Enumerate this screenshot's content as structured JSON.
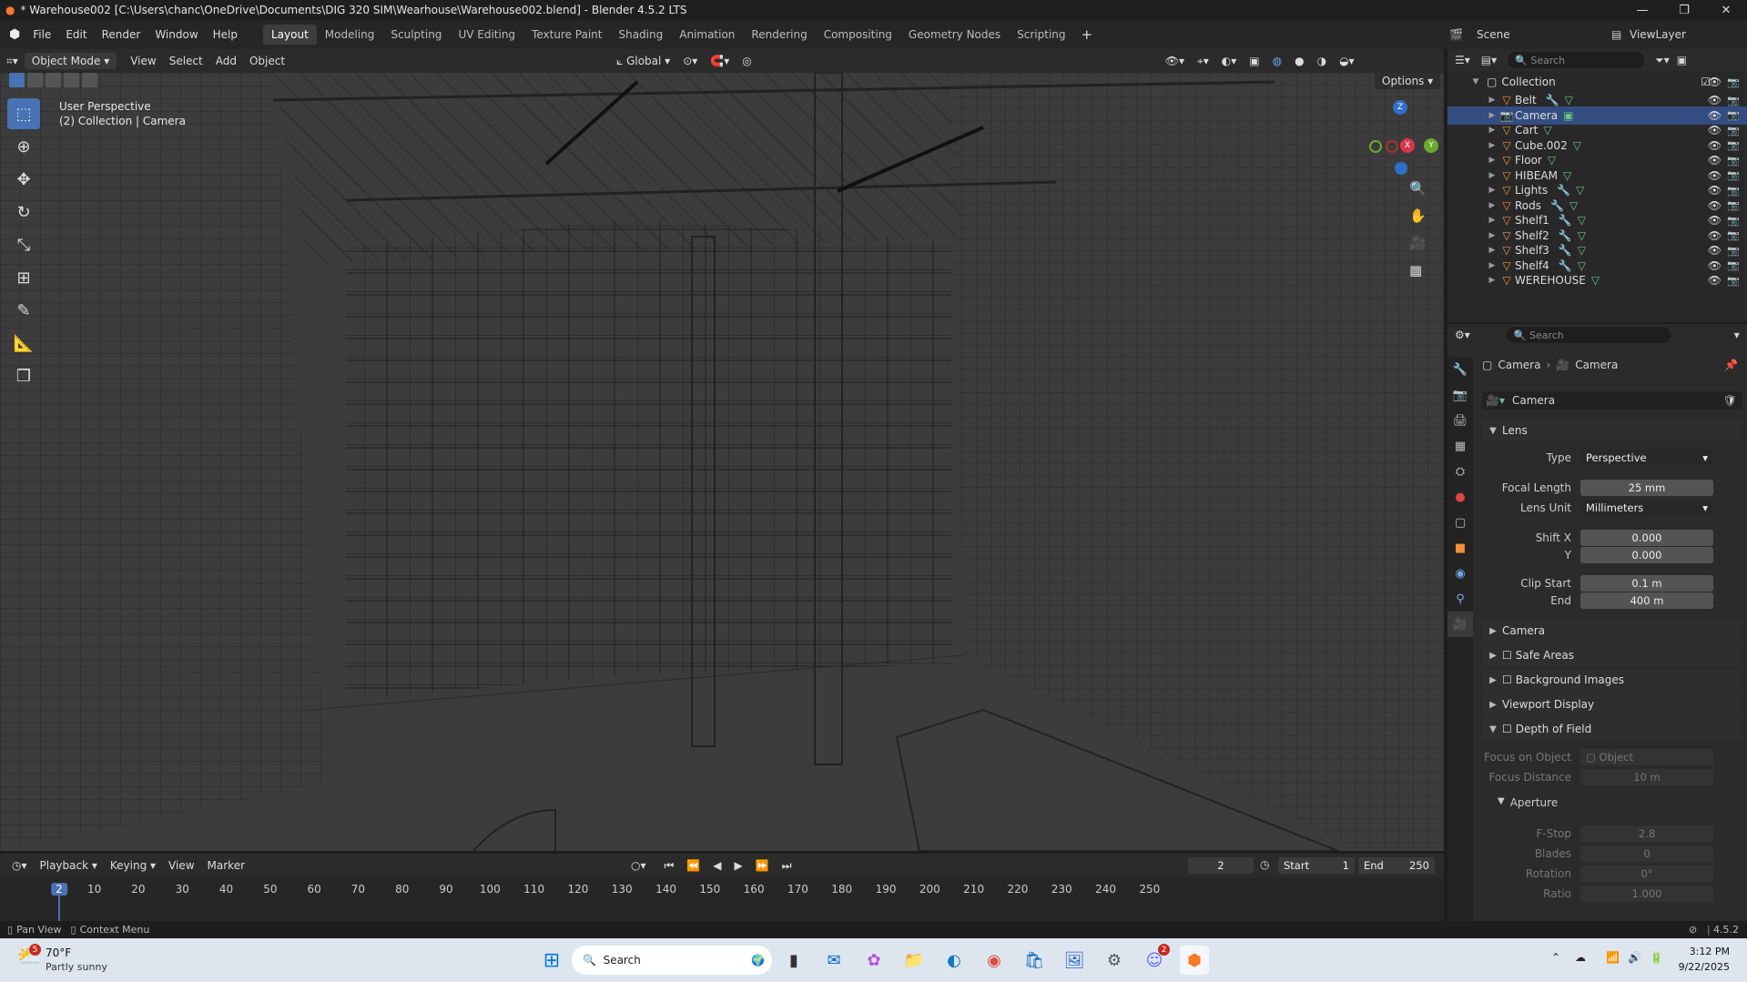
{
  "title": "* Warehouse002 [C:\\Users\\chanc\\OneDrive\\Documents\\DIG 320 SIM\\Wearhouse\\Warehouse002.blend] - Blender 4.5.2 LTS",
  "menu": [
    "File",
    "Edit",
    "Render",
    "Window",
    "Help"
  ],
  "workspaces": [
    "Layout",
    "Modeling",
    "Sculpting",
    "UV Editing",
    "Texture Paint",
    "Shading",
    "Animation",
    "Rendering",
    "Compositing",
    "Geometry Nodes",
    "Scripting"
  ],
  "active_workspace": "Layout",
  "scene": {
    "label": "Scene",
    "view_layer": "ViewLayer"
  },
  "viewport": {
    "mode": "Object Mode",
    "menus": [
      "View",
      "Select",
      "Add",
      "Object"
    ],
    "transform": "Global",
    "options": "Options",
    "overlay_line1": "User Perspective",
    "overlay_line2": "(2) Collection | Camera",
    "gizmo": {
      "x": "X",
      "y": "Y",
      "z": "Z"
    }
  },
  "outliner": {
    "search": "Search",
    "collection": "Collection",
    "items": [
      {
        "name": "Belt",
        "mod": true,
        "sel": false
      },
      {
        "name": "Camera",
        "mod": false,
        "sel": true
      },
      {
        "name": "Cart",
        "mod": false,
        "sel": false
      },
      {
        "name": "Cube.002",
        "mod": false,
        "sel": false
      },
      {
        "name": "Floor",
        "mod": false,
        "sel": false
      },
      {
        "name": "HIBEAM",
        "mod": false,
        "sel": false
      },
      {
        "name": "Lights",
        "mod": true,
        "sel": false
      },
      {
        "name": "Rods",
        "mod": true,
        "sel": false
      },
      {
        "name": "Shelf1",
        "mod": true,
        "sel": false
      },
      {
        "name": "Shelf2",
        "mod": true,
        "sel": false
      },
      {
        "name": "Shelf3",
        "mod": true,
        "sel": false
      },
      {
        "name": "Shelf4",
        "mod": true,
        "sel": false
      },
      {
        "name": "WEREHOUSE",
        "mod": false,
        "sel": false
      }
    ]
  },
  "properties": {
    "search": "Search",
    "breadcrumb": [
      "Camera",
      "Camera"
    ],
    "datablock": "Camera",
    "lens_header": "Lens",
    "type_label": "Type",
    "type_value": "Perspective",
    "focal_label": "Focal Length",
    "focal_value": "25 mm",
    "unit_label": "Lens Unit",
    "unit_value": "Millimeters",
    "shiftx_label": "Shift X",
    "shiftx_value": "0.000",
    "shifty_label": "Y",
    "shifty_value": "0.000",
    "clipstart_label": "Clip Start",
    "clipstart_value": "0.1 m",
    "clipend_label": "End",
    "clipend_value": "400 m",
    "panels": [
      "Camera",
      "Safe Areas",
      "Background Images",
      "Viewport Display",
      "Depth of Field"
    ],
    "focus_obj_label": "Focus on Object",
    "focus_obj_value": "Object",
    "focus_dist_label": "Focus Distance",
    "focus_dist_value": "10 m",
    "aperture": "Aperture",
    "fstop_label": "F-Stop",
    "fstop_value": "2.8",
    "blades_label": "Blades",
    "blades_value": "0",
    "rotation_label": "Rotation",
    "rotation_value": "0°",
    "ratio_label": "Ratio",
    "ratio_value": "1.000"
  },
  "timeline": {
    "menus": [
      "Playback",
      "Keying",
      "View",
      "Marker"
    ],
    "current_frame": "2",
    "start_label": "Start",
    "start_value": "1",
    "end_label": "End",
    "end_value": "250",
    "ticks": [
      "2",
      "10",
      "20",
      "30",
      "40",
      "50",
      "60",
      "70",
      "80",
      "90",
      "100",
      "110",
      "120",
      "130",
      "140",
      "150",
      "160",
      "170",
      "180",
      "190",
      "200",
      "210",
      "220",
      "230",
      "240",
      "250"
    ]
  },
  "status": {
    "left1": "Pan View",
    "left2": "Context Menu",
    "version": "4.5.2"
  },
  "taskbar": {
    "weather_badge": "5",
    "temp": "70°F",
    "weather": "Partly sunny",
    "search": "Search",
    "time": "3:12 PM",
    "date": "9/22/2025",
    "discord_badge": "2"
  }
}
